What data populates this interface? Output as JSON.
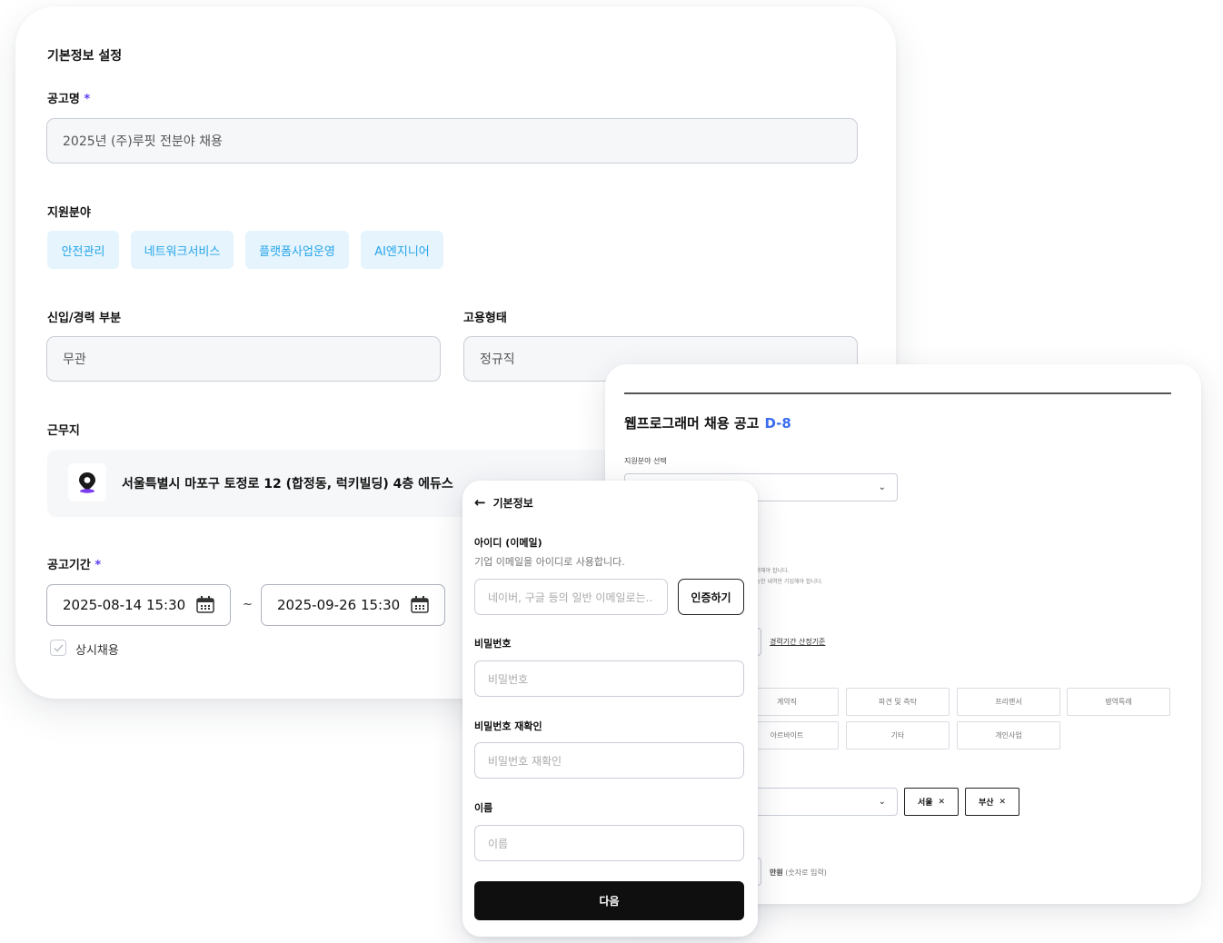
{
  "basic_info": {
    "section_title": "기본정보 설정",
    "required_mark": "*",
    "posting_name": {
      "label": "공고명",
      "value": "2025년 (주)루핏 전분야 채용"
    },
    "fields": {
      "label": "지원분야",
      "chips": [
        "안전관리",
        "네트워크서비스",
        "플랫폼사업운영",
        "AI엔지니어"
      ]
    },
    "career": {
      "label": "신입/경력 부분",
      "value": "무관"
    },
    "employment": {
      "label": "고용형태",
      "value": "정규직"
    },
    "location": {
      "label": "근무지",
      "address": "서울특별시 마포구 토정로 12 (합정동, 럭키빌딩) 4층 에듀스",
      "icon": "map-pin-icon",
      "icon_color": "#7b3cf0"
    },
    "period": {
      "label": "공고기간",
      "start": "2025-08-14 15:30",
      "separator": "~",
      "end": "2025-09-26 15:30",
      "always_hiring_label": "상시채용",
      "always_hiring_checked": false
    }
  },
  "job_posting": {
    "title": "웹프로그래머 채용 공고",
    "dday": "D-8",
    "field_select_label": "지원분야 선택",
    "notes": [
      "입력해야 합니다.",
      "가능한 내역만 기입해야 합니다."
    ],
    "career_link": "경력기간 산정기준",
    "employment_types": [
      "계약직",
      "파견 및 측탁",
      "프리랜서",
      "병역특례",
      "아르바이트",
      "기타",
      "개인사업"
    ],
    "region_tags": [
      "서울",
      "부산"
    ],
    "salary_unit": "만원",
    "salary_hint": "(숫자로 입력)"
  },
  "signup": {
    "back_title": "기본정보",
    "id_label": "아이디 (이메일)",
    "id_hint": "기업 이메일을 아이디로 사용합니다.",
    "id_placeholder": "네이버, 구글 등의 일반 이메일로는..",
    "verify_button": "인증하기",
    "password_label": "비밀번호",
    "password_placeholder": "비밀번호",
    "password_confirm_label": "비밀번호 재확인",
    "password_confirm_placeholder": "비밀번호 재확인",
    "name_label": "이름",
    "name_placeholder": "이름",
    "next_button": "다음"
  }
}
